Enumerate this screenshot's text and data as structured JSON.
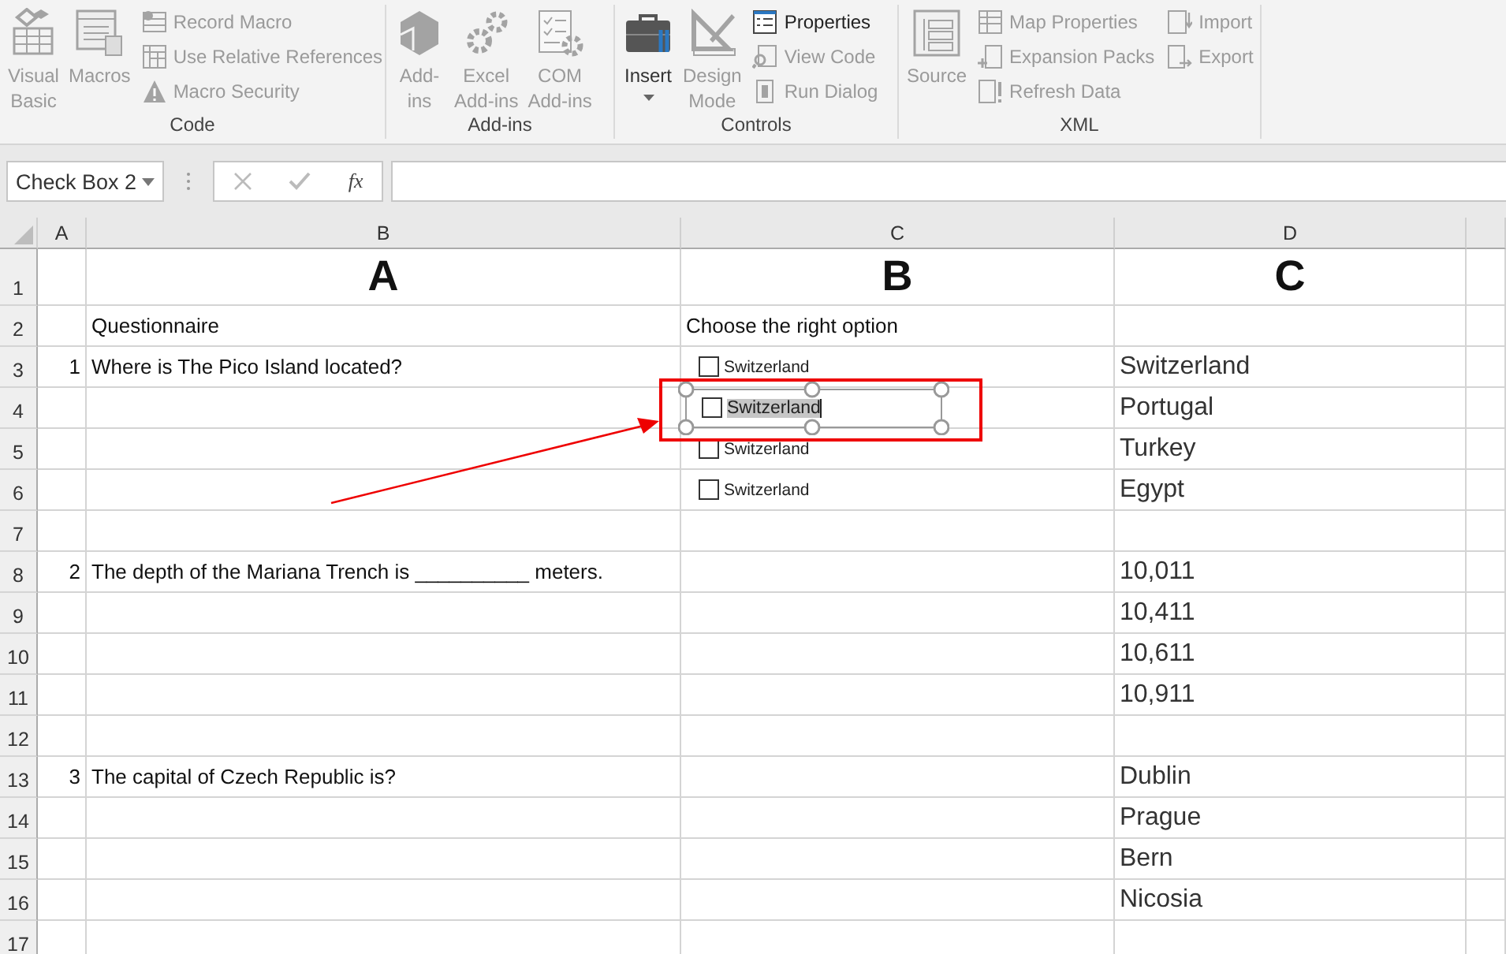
{
  "ribbon": {
    "groups": [
      {
        "label": "Code",
        "columns": [
          {
            "items": [
              {
                "label": "Visual\nBasic",
                "kind": "large",
                "disabled": true
              }
            ]
          },
          {
            "items": [
              {
                "label": "Macros",
                "kind": "large",
                "disabled": true
              }
            ]
          },
          {
            "items": [
              {
                "label": "Record Macro",
                "kind": "small",
                "disabled": true
              },
              {
                "label": "Use Relative References",
                "kind": "small",
                "disabled": true
              },
              {
                "label": "Macro Security",
                "kind": "small",
                "disabled": true
              }
            ]
          }
        ]
      },
      {
        "label": "Add-ins",
        "columns": [
          {
            "items": [
              {
                "label": "Add-\nins",
                "kind": "large",
                "disabled": true
              }
            ]
          },
          {
            "items": [
              {
                "label": "Excel\nAdd-ins",
                "kind": "large",
                "disabled": true
              }
            ]
          },
          {
            "items": [
              {
                "label": "COM\nAdd-ins",
                "kind": "large",
                "disabled": true
              }
            ]
          }
        ]
      },
      {
        "label": "Controls",
        "columns": [
          {
            "items": [
              {
                "label": "Insert",
                "kind": "large",
                "disabled": false,
                "dropdown": true
              }
            ]
          },
          {
            "items": [
              {
                "label": "Design\nMode",
                "kind": "large",
                "disabled": true
              }
            ]
          },
          {
            "items": [
              {
                "label": "Properties",
                "kind": "small",
                "disabled": false
              },
              {
                "label": "View Code",
                "kind": "small",
                "disabled": true
              },
              {
                "label": "Run Dialog",
                "kind": "small",
                "disabled": true
              }
            ]
          }
        ]
      },
      {
        "label": "XML",
        "columns": [
          {
            "items": [
              {
                "label": "Source",
                "kind": "large",
                "disabled": true
              }
            ]
          },
          {
            "items": [
              {
                "label": "Map Properties",
                "kind": "small",
                "disabled": true
              },
              {
                "label": "Expansion Packs",
                "kind": "small",
                "disabled": true
              },
              {
                "label": "Refresh Data",
                "kind": "small",
                "disabled": true
              }
            ]
          },
          {
            "items": [
              {
                "label": "Import",
                "kind": "small",
                "disabled": true
              },
              {
                "label": "Export",
                "kind": "small",
                "disabled": true
              }
            ]
          }
        ]
      }
    ]
  },
  "formula_bar": {
    "name_box": "Check Box 2",
    "function_label": "fx"
  },
  "sheet": {
    "columns": [
      "A",
      "B",
      "C",
      "D"
    ],
    "rows": [
      {
        "number": "1",
        "kind": "heading",
        "b": "A",
        "c": "B",
        "d": "C"
      },
      {
        "number": "2",
        "kind": "text",
        "b": "Questionnaire",
        "c": "Choose the right option"
      },
      {
        "number": "3",
        "kind": "text",
        "a": "1",
        "b": "Where is The Pico Island located?",
        "d": "Switzerland",
        "checkbox": {
          "label": "Switzerland",
          "checked": false,
          "selected": false
        }
      },
      {
        "number": "4",
        "kind": "text",
        "d": "Portugal",
        "checkbox": {
          "label": "Switzerland",
          "checked": false,
          "selected": true
        }
      },
      {
        "number": "5",
        "kind": "text",
        "d": "Turkey",
        "checkbox": {
          "label": "Switzerland",
          "checked": false,
          "selected": false
        }
      },
      {
        "number": "6",
        "kind": "text",
        "d": "Egypt",
        "checkbox": {
          "label": "Switzerland",
          "checked": false,
          "selected": false
        }
      },
      {
        "number": "7",
        "kind": "text"
      },
      {
        "number": "8",
        "kind": "text",
        "a": "2",
        "b": "The depth of the Mariana Trench is __________ meters.",
        "d": "10,011"
      },
      {
        "number": "9",
        "kind": "text",
        "d": "10,411"
      },
      {
        "number": "10",
        "kind": "text",
        "d": "10,611"
      },
      {
        "number": "11",
        "kind": "text",
        "d": "10,911"
      },
      {
        "number": "12",
        "kind": "text"
      },
      {
        "number": "13",
        "kind": "text",
        "a": "3",
        "b": "The capital of Czech Republic is?",
        "d": "Dublin"
      },
      {
        "number": "14",
        "kind": "text",
        "d": "Prague"
      },
      {
        "number": "15",
        "kind": "text",
        "d": "Bern"
      },
      {
        "number": "16",
        "kind": "text",
        "d": "Nicosia"
      },
      {
        "number": "17",
        "kind": "text"
      }
    ]
  },
  "annotations": [
    {
      "kind": "highlight-box"
    },
    {
      "kind": "arrow"
    }
  ]
}
